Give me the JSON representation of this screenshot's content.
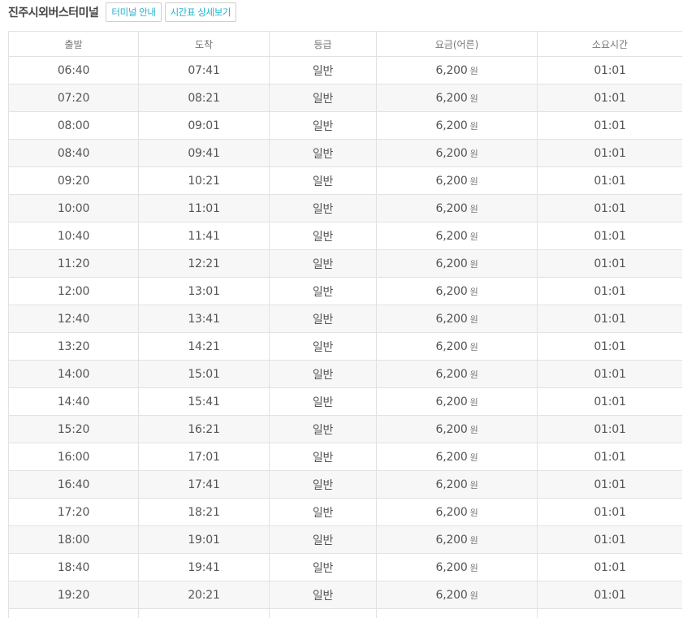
{
  "header": {
    "terminal_name": "진주시외버스터미널",
    "terminal_info_button": "터미널 안내",
    "timetable_detail_button": "시간표 상세보기"
  },
  "table": {
    "columns": [
      "출발",
      "도착",
      "등급",
      "요금(어른)",
      "소요시간"
    ],
    "currency_unit": "원",
    "rows": [
      {
        "depart": "06:40",
        "arrive": "07:41",
        "grade": "일반",
        "fare": "6,200",
        "duration": "01:01"
      },
      {
        "depart": "07:20",
        "arrive": "08:21",
        "grade": "일반",
        "fare": "6,200",
        "duration": "01:01"
      },
      {
        "depart": "08:00",
        "arrive": "09:01",
        "grade": "일반",
        "fare": "6,200",
        "duration": "01:01"
      },
      {
        "depart": "08:40",
        "arrive": "09:41",
        "grade": "일반",
        "fare": "6,200",
        "duration": "01:01"
      },
      {
        "depart": "09:20",
        "arrive": "10:21",
        "grade": "일반",
        "fare": "6,200",
        "duration": "01:01"
      },
      {
        "depart": "10:00",
        "arrive": "11:01",
        "grade": "일반",
        "fare": "6,200",
        "duration": "01:01"
      },
      {
        "depart": "10:40",
        "arrive": "11:41",
        "grade": "일반",
        "fare": "6,200",
        "duration": "01:01"
      },
      {
        "depart": "11:20",
        "arrive": "12:21",
        "grade": "일반",
        "fare": "6,200",
        "duration": "01:01"
      },
      {
        "depart": "12:00",
        "arrive": "13:01",
        "grade": "일반",
        "fare": "6,200",
        "duration": "01:01"
      },
      {
        "depart": "12:40",
        "arrive": "13:41",
        "grade": "일반",
        "fare": "6,200",
        "duration": "01:01"
      },
      {
        "depart": "13:20",
        "arrive": "14:21",
        "grade": "일반",
        "fare": "6,200",
        "duration": "01:01"
      },
      {
        "depart": "14:00",
        "arrive": "15:01",
        "grade": "일반",
        "fare": "6,200",
        "duration": "01:01"
      },
      {
        "depart": "14:40",
        "arrive": "15:41",
        "grade": "일반",
        "fare": "6,200",
        "duration": "01:01"
      },
      {
        "depart": "15:20",
        "arrive": "16:21",
        "grade": "일반",
        "fare": "6,200",
        "duration": "01:01"
      },
      {
        "depart": "16:00",
        "arrive": "17:01",
        "grade": "일반",
        "fare": "6,200",
        "duration": "01:01"
      },
      {
        "depart": "16:40",
        "arrive": "17:41",
        "grade": "일반",
        "fare": "6,200",
        "duration": "01:01"
      },
      {
        "depart": "17:20",
        "arrive": "18:21",
        "grade": "일반",
        "fare": "6,200",
        "duration": "01:01"
      },
      {
        "depart": "18:00",
        "arrive": "19:01",
        "grade": "일반",
        "fare": "6,200",
        "duration": "01:01"
      },
      {
        "depart": "18:40",
        "arrive": "19:41",
        "grade": "일반",
        "fare": "6,200",
        "duration": "01:01"
      },
      {
        "depart": "19:20",
        "arrive": "20:21",
        "grade": "일반",
        "fare": "6,200",
        "duration": "01:01"
      }
    ]
  }
}
